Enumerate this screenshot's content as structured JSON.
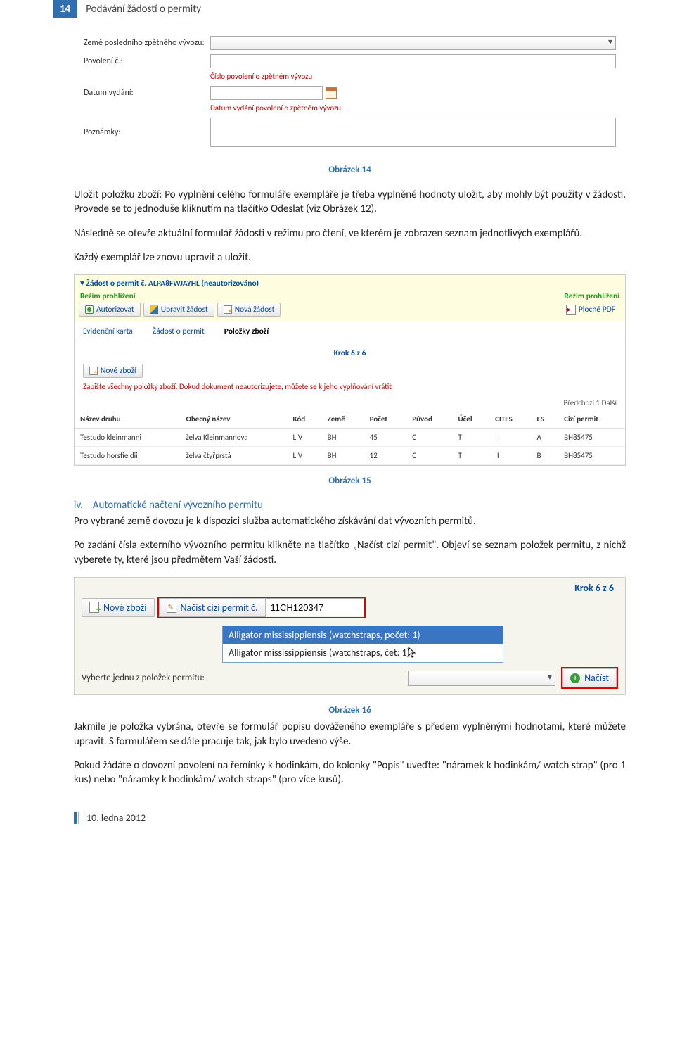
{
  "header": {
    "pagenum": "14",
    "title": "Podávání žádostí o permity"
  },
  "fig1": {
    "rows": {
      "country_label": "Země posledního zpětného vývozu:",
      "permit_label": "Povolení č.:",
      "permit_hint": "Číslo povolení o zpětném vývozu",
      "date_label": "Datum vydání:",
      "date_hint": "Datum vydání povolení o zpětném vývozu",
      "notes_label": "Poznámky:"
    }
  },
  "cap14": "Obrázek 14",
  "para1": "Uložit položku zboží: Po vyplnění celého formuláře exempláře je třeba vyplněné hodnoty uložit, aby mohly být použity v žádosti. Provede se to jednoduše kliknutím na tlačítko Odeslat (viz Obrázek 12).",
  "para2": "Následně se otevře aktuální formulář žádosti v režimu pro čtení, ve kterém je zobrazen seznam jednotlivých exemplářů.",
  "para3": "Každý exemplář lze znovu upravit a uložit.",
  "fig2": {
    "topbar_title": "Žádost o permit č. ALPA8FWJAYHL (neautorizováno)",
    "mode_left": "Režim prohlížení",
    "mode_right": "Režim prohlížení",
    "btn_auth": "Autorizovat",
    "btn_edit": "Upravit žádost",
    "btn_new": "Nová žádost",
    "btn_pdf": "Ploché PDF",
    "tabs": {
      "t1": "Evidenční karta",
      "t2": "Žádost o permit",
      "t3": "Položky zboží"
    },
    "krok": "Krok 6 z 6",
    "btn_newitem": "Nové zboží",
    "rednote": "Zapište všechny položky zboží. Dokud dokument neautorizujete, můžete se k jeho vyplňování vrátit",
    "pager": "Předchozí   1   Další",
    "cols": {
      "c1": "Název druhu",
      "c2": "Obecný název",
      "c3": "Kód",
      "c4": "Země",
      "c5": "Počet",
      "c6": "Původ",
      "c7": "Účel",
      "c8": "CITES",
      "c9": "ES",
      "c10": "Cizí permit"
    },
    "rows": [
      {
        "c1": "Testudo kleinmanni",
        "c2": "želva Kleinmannova",
        "c3": "LIV",
        "c4": "BH",
        "c5": "45",
        "c6": "C",
        "c7": "T",
        "c8": "I",
        "c9": "A",
        "c10": "BH85475"
      },
      {
        "c1": "Testudo horsfieldii",
        "c2": "želva čtyřprstá",
        "c3": "LIV",
        "c4": "BH",
        "c5": "12",
        "c6": "C",
        "c7": "T",
        "c8": "II",
        "c9": "B",
        "c10": "BH85475"
      }
    ]
  },
  "cap15": "Obrázek 15",
  "section4": {
    "num": "iv.",
    "title": "Automatické načtení vývozního permitu"
  },
  "para4": "Pro vybrané země dovozu je k dispozici služba automatického získávání dat vývozních permitů.",
  "para5": "Po zadání čísla externího vývozního permitu klikněte na tlačítko „Načíst cizí permit\". Objeví se seznam položek permitu, z nichž vyberete ty, které jsou předmětem Vaší žádosti.",
  "fig3": {
    "krok": "Krok 6 z 6",
    "btn_new": "Nové zboží",
    "btn_load": "Načíst cizí permit č.",
    "input_val": "11CH120347",
    "opt1": "Alligator mississippiensis (watchstraps, počet: 1)",
    "opt2": "Alligator mississippiensis (watchstraps,      čet: 1)",
    "bottom_label": "Vyberte jednu z položek permitu:",
    "btn_go": "Načíst"
  },
  "cap16": "Obrázek 16",
  "para6": "Jakmile je položka vybrána, otevře se formulář popisu dováženého exempláře s předem vyplněnými hodnotami, které můžete upravit. S formulářem se dále pracuje tak, jak bylo uvedeno výše.",
  "para7": "Pokud žádáte o dovozní povolení na řemínky k hodinkám, do kolonky \"Popis\" uveďte: \"náramek k hodinkám/ watch strap\" (pro 1 kus) nebo \"náramky k hodinkám/ watch straps\" (pro více kusů).",
  "footer_date": "10. ledna 2012"
}
